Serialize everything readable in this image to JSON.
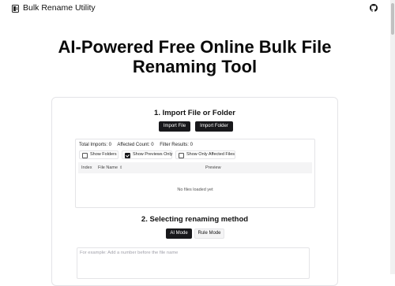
{
  "app": {
    "title": "Bulk Rename Utility"
  },
  "hero": {
    "line1": "AI-Powered Free Online Bulk File",
    "line2": "Renaming Tool"
  },
  "import_section": {
    "title": "1. Import File or Folder",
    "import_file_label": "Import File",
    "import_folder_label": "Import Folder",
    "stats": {
      "total_imports": "Total Imports: 0",
      "affected_count": "Affected Count: 0",
      "filter_results": "Filter Results: 0"
    },
    "filters": [
      {
        "label": "Show Folders",
        "checked": false
      },
      {
        "label": "Show Previews Only",
        "checked": true
      },
      {
        "label": "Show Only Affected Files",
        "checked": false
      }
    ],
    "table": {
      "headers": {
        "index": "Index",
        "file_name": "File Name",
        "preview": "Preview"
      },
      "empty_message": "No files loaded yet"
    }
  },
  "method_section": {
    "title": "2. Selecting renaming method",
    "ai_mode_label": "AI Mode",
    "rule_mode_label": "Rule Mode",
    "prompt_placeholder": "For example: Add a number before the file name"
  },
  "colors": {
    "primary": "#18181b",
    "border": "#e4e4e7",
    "muted_bg": "#f4f4f5"
  },
  "icons": {
    "logo": "file-rename-icon",
    "github": "github-icon",
    "sort": "sort-icon"
  }
}
